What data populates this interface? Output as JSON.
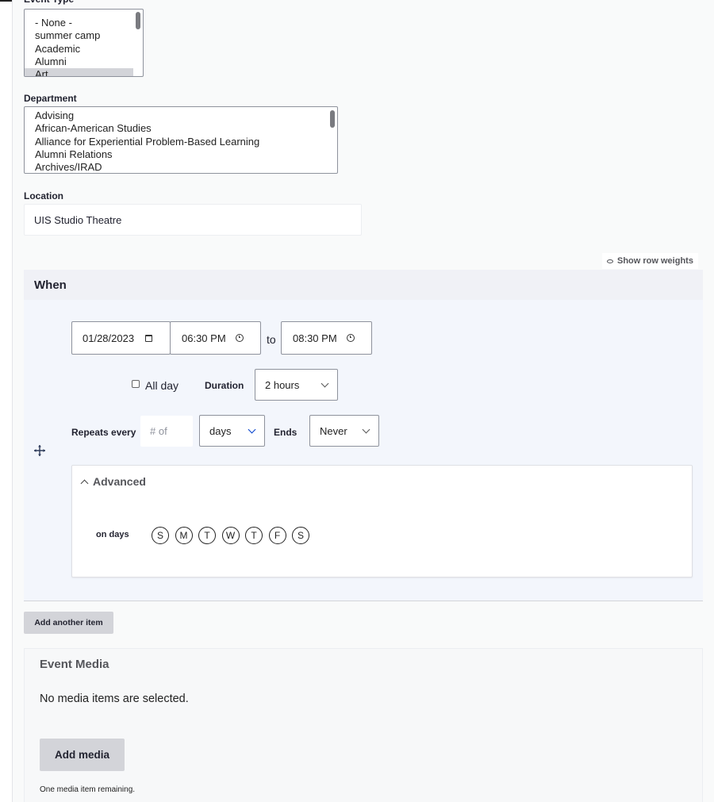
{
  "event_type": {
    "label": "Event Type",
    "options": [
      "- None -",
      "summer camp",
      "Academic",
      "Alumni",
      "Art"
    ],
    "selected": "Art"
  },
  "department": {
    "label": "Department",
    "options": [
      "Advising",
      "African-American Studies",
      "Alliance for Experiential Problem-Based Learning",
      "Alumni Relations",
      "Archives/IRAD"
    ]
  },
  "location": {
    "label": "Location",
    "value": "UIS Studio Theatre"
  },
  "show_row_weights": "Show row weights",
  "when": {
    "title": "When",
    "date": "01/28/2023",
    "start_time": "06:30 PM",
    "to_label": "to",
    "end_time": "08:30 PM",
    "all_day_label": "All day",
    "all_day_checked": false,
    "duration_label": "Duration",
    "duration_value": "2 hours",
    "repeats_label": "Repeats every",
    "repeats_placeholder": "# of",
    "repeats_unit": "days",
    "ends_label": "Ends",
    "ends_value": "Never",
    "advanced": {
      "title": "Advanced",
      "on_days_label": "on days",
      "days": [
        "S",
        "M",
        "T",
        "W",
        "T",
        "F",
        "S"
      ]
    }
  },
  "add_another_item": "Add another item",
  "event_media": {
    "title": "Event Media",
    "empty_text": "No media items are selected.",
    "add_button": "Add media",
    "remaining_text": "One media item remaining."
  }
}
